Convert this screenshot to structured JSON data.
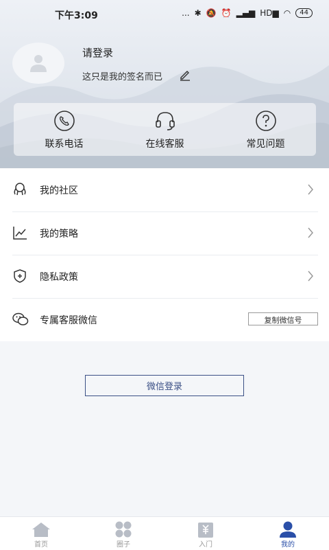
{
  "status_bar": {
    "time": "下午3:09",
    "dots": "...",
    "battery": "44",
    "signal": "HD"
  },
  "profile": {
    "login_prompt": "请登录",
    "signature": "这只是我的签名而已"
  },
  "quick_actions": [
    {
      "label": "联系电话",
      "icon": "phone-icon"
    },
    {
      "label": "在线客服",
      "icon": "headset-icon"
    },
    {
      "label": "常见问题",
      "icon": "question-icon"
    }
  ],
  "menu": [
    {
      "label": "我的社区",
      "icon": "community-icon"
    },
    {
      "label": "我的策略",
      "icon": "chart-line-icon"
    },
    {
      "label": "隐私政策",
      "icon": "shield-icon"
    },
    {
      "label": "专属客服微信",
      "icon": "wechat-icon",
      "action": "复制微信号"
    }
  ],
  "wechat_login": "微信登录",
  "tabs": [
    {
      "label": "首页",
      "icon": "home-icon",
      "active": false
    },
    {
      "label": "圈子",
      "icon": "circle-icon",
      "active": false
    },
    {
      "label": "入门",
      "icon": "clipboard-icon",
      "active": false
    },
    {
      "label": "我的",
      "icon": "user-icon",
      "active": true
    }
  ],
  "colors": {
    "accent": "#2a4fa8",
    "button_border": "#3a4f85",
    "inactive_tab": "#b8bdc6"
  }
}
